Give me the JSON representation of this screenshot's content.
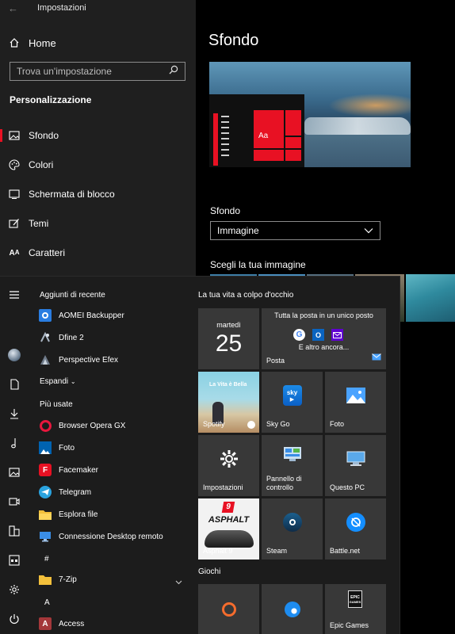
{
  "settings": {
    "app_title": "Impostazioni",
    "home_label": "Home",
    "search_placeholder": "Trova un'impostazione",
    "section": "Personalizzazione",
    "nav_items": [
      {
        "label": "Sfondo",
        "icon": "image-icon",
        "active": true
      },
      {
        "label": "Colori",
        "icon": "palette-icon",
        "active": false
      },
      {
        "label": "Schermata di blocco",
        "icon": "lock-screen-icon",
        "active": false
      },
      {
        "label": "Temi",
        "icon": "brush-icon",
        "active": false
      },
      {
        "label": "Caratteri",
        "icon": "font-icon",
        "active": false
      }
    ],
    "page_title": "Sfondo",
    "preview_tile_text": "Aa",
    "background_label": "Sfondo",
    "background_value": "Immagine",
    "choose_label": "Scegli la tua immagine",
    "accent_color": "#e81123"
  },
  "start": {
    "recent_head": "Aggiunti di recente",
    "recent_apps": [
      {
        "label": "AOMEI Backupper",
        "icon": "aomei-icon"
      },
      {
        "label": "Dfine 2",
        "icon": "dfine-icon"
      },
      {
        "label": "Perspective Efex",
        "icon": "perspective-efex-icon"
      }
    ],
    "expand_label": "Espandi",
    "most_used_head": "Più usate",
    "most_used_apps": [
      {
        "label": "Browser Opera GX",
        "icon": "opera-gx-icon"
      },
      {
        "label": "Foto",
        "icon": "photos-icon"
      },
      {
        "label": "Facemaker",
        "icon": "facemaker-icon"
      },
      {
        "label": "Telegram",
        "icon": "telegram-icon"
      },
      {
        "label": "Esplora file",
        "icon": "file-explorer-icon"
      },
      {
        "label": "Connessione Desktop remoto",
        "icon": "remote-desktop-icon"
      }
    ],
    "letter_hash": "#",
    "folder_app": "7-Zip",
    "letter_a": "A",
    "access_app": "Access",
    "tiles_head": "La tua vita a colpo d'occhio",
    "calendar_day": "martedì",
    "calendar_date": "25",
    "mail_headline": "Tutta la posta in un unico posto",
    "mail_more": "E altro ancora...",
    "mail_label": "Posta",
    "spotify_banner": "La Vita è Bella",
    "spotify_label": "Spotify",
    "skygo_label": "Sky Go",
    "foto_label": "Foto",
    "impostazioni_label": "Impostazioni",
    "pannello_label": "Pannello di controllo",
    "questopc_label": "Questo PC",
    "asphalt_label": "Asphalt 9",
    "asphalt_logo": "ASPHALT",
    "asphalt_num": "9",
    "steam_label": "Steam",
    "battlenet_label": "Battle.net",
    "games_head": "Giochi",
    "epic_label": "Epic Games",
    "epic_logo_top": "EPIC",
    "epic_logo_bottom": "GAMES"
  }
}
